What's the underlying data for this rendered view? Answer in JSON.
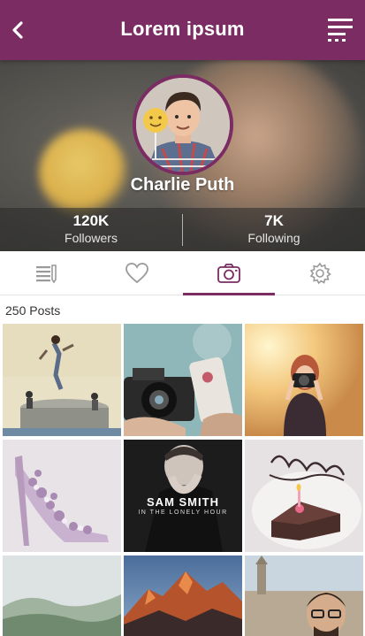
{
  "header": {
    "title": "Lorem ipsum",
    "bar_color": "#7a2c63",
    "back_icon": "chevron-left-icon",
    "menu_icon": "hamburger-menu-icon"
  },
  "profile": {
    "name": "Charlie Puth",
    "avatar_icon": "profile-photo",
    "stats": [
      {
        "value": "120K",
        "label": "Followers"
      },
      {
        "value": "7K",
        "label": "Following"
      }
    ]
  },
  "tabs": [
    {
      "icon": "list-icon",
      "active": false
    },
    {
      "icon": "heart-icon",
      "active": false
    },
    {
      "icon": "camera-icon",
      "active": true
    },
    {
      "icon": "gear-icon",
      "active": false
    }
  ],
  "accent_color": "#7a2c63",
  "posts": {
    "count_label": "250 Posts",
    "album_title": "SAM SMITH",
    "album_subtitle": "IN THE LONELY HOUR"
  }
}
